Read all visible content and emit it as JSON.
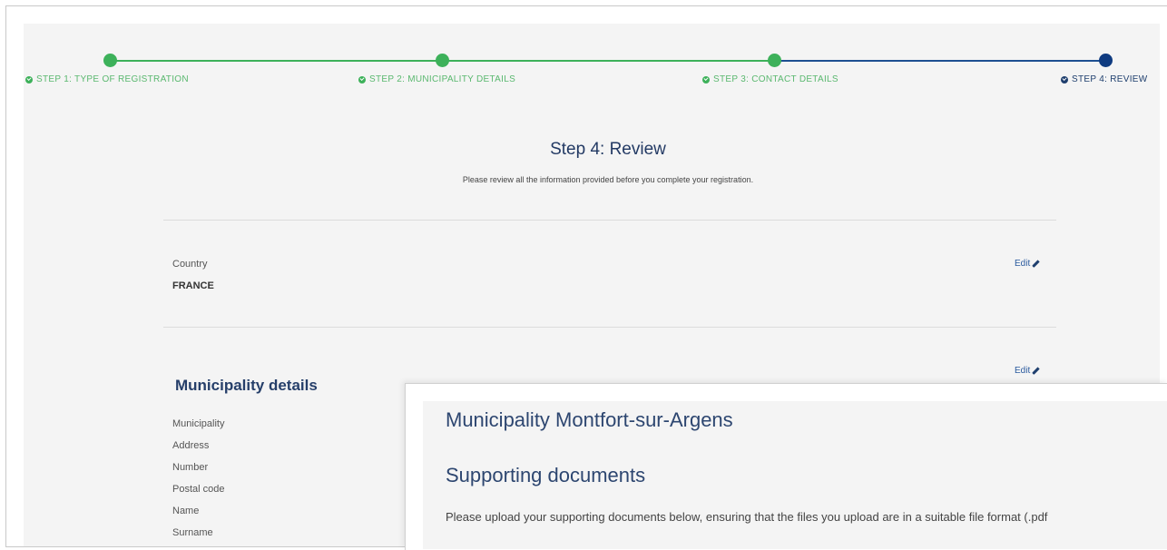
{
  "stepper": {
    "steps": [
      {
        "label": "STEP 1: TYPE OF REGISTRATION",
        "state": "complete"
      },
      {
        "label": "STEP 2: MUNICIPALITY DETAILS",
        "state": "complete"
      },
      {
        "label": "STEP 3: CONTACT DETAILS",
        "state": "complete"
      },
      {
        "label": "STEP 4: REVIEW",
        "state": "active"
      }
    ],
    "colors": {
      "complete": "#3db15a",
      "active": "#1d4f91"
    }
  },
  "review": {
    "title": "Step 4: Review",
    "subtitle": "Please review all the information provided before you complete your registration."
  },
  "country_section": {
    "label": "Country",
    "value": "FRANCE",
    "edit_label": "Edit"
  },
  "municipality_section": {
    "heading": "Municipality details",
    "edit_label": "Edit",
    "fields": [
      "Municipality",
      "Address",
      "Number",
      "Postal code",
      "Name",
      "Surname"
    ]
  },
  "overlay": {
    "title": "Municipality Montfort-sur-Argens",
    "heading": "Supporting documents",
    "text": "Please upload your supporting documents below, ensuring that the files you upload are in a suitable file format (.pdf"
  }
}
